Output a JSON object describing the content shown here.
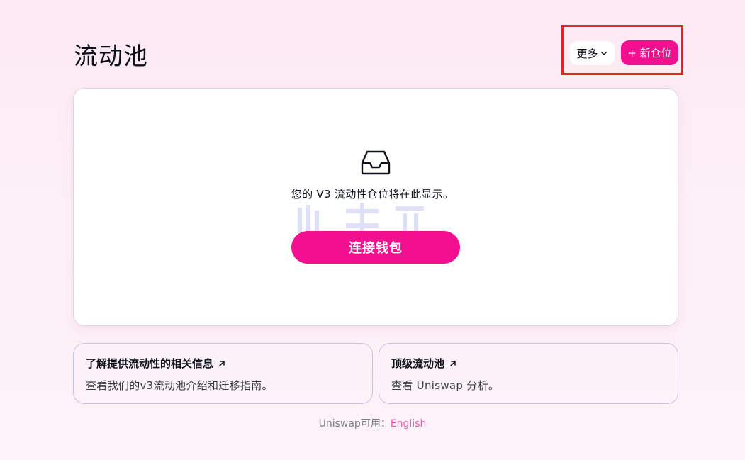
{
  "header": {
    "title": "流动池",
    "more_label": "更多",
    "new_position_label": "+ 新仓位"
  },
  "empty_state": {
    "icon": "inbox-icon",
    "message": "您的 V3 流动性仓位将在此显示。",
    "connect_wallet_label": "连接钱包"
  },
  "info_cards": [
    {
      "title": "了解提供流动性的相关信息",
      "description": "查看我们的v3流动池介绍和迁移指南。"
    },
    {
      "title": "顶级流动池",
      "description": "查看 Uniswap 分析。"
    }
  ],
  "footer": {
    "available_text": "Uniswap可用：",
    "language_link": "English"
  },
  "colors": {
    "accent": "#f2108e",
    "highlight": "#e8231c",
    "link": "#e85bb2"
  }
}
